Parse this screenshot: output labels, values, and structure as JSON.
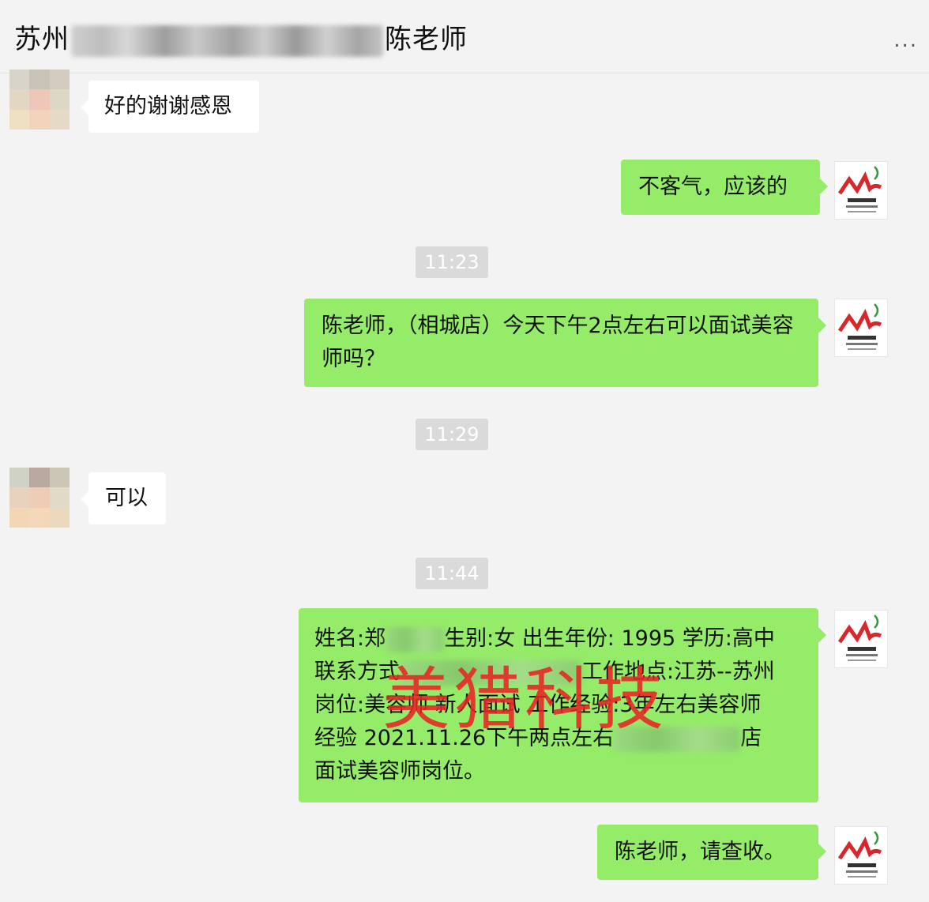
{
  "header": {
    "title_prefix": "苏州",
    "title_suffix": "陈老师",
    "more_label": "..."
  },
  "messages": {
    "m1": "好的谢谢感恩",
    "m2": "不客气，应该的",
    "m3": "陈老师，（相城店）今天下午2点左右可以面试美容师吗？",
    "m4": "可以",
    "m5": {
      "line1a": "姓名:郑",
      "line1b": "生别:女 出生年份: 1995 学历:高中",
      "line2a": "联系方式",
      "line2b": "工作地点:江苏--苏州",
      "line3": "岗位:美容师 新人面试 工作经验:3年左右美容师",
      "line4a": "经验 2021.11.26下午两点左右",
      "line4b": "店",
      "line5": "面试美容师岗位。"
    },
    "m6": "陈老师，请查收。"
  },
  "timestamps": [
    "11:23",
    "11:29",
    "11:44"
  ],
  "watermark": "美猎科技",
  "colors": {
    "background": "#f3f3f3",
    "bubble_out": "#95ec69",
    "bubble_in": "#ffffff",
    "timestamp_bg": "#dadada",
    "watermark": "#e82323"
  }
}
